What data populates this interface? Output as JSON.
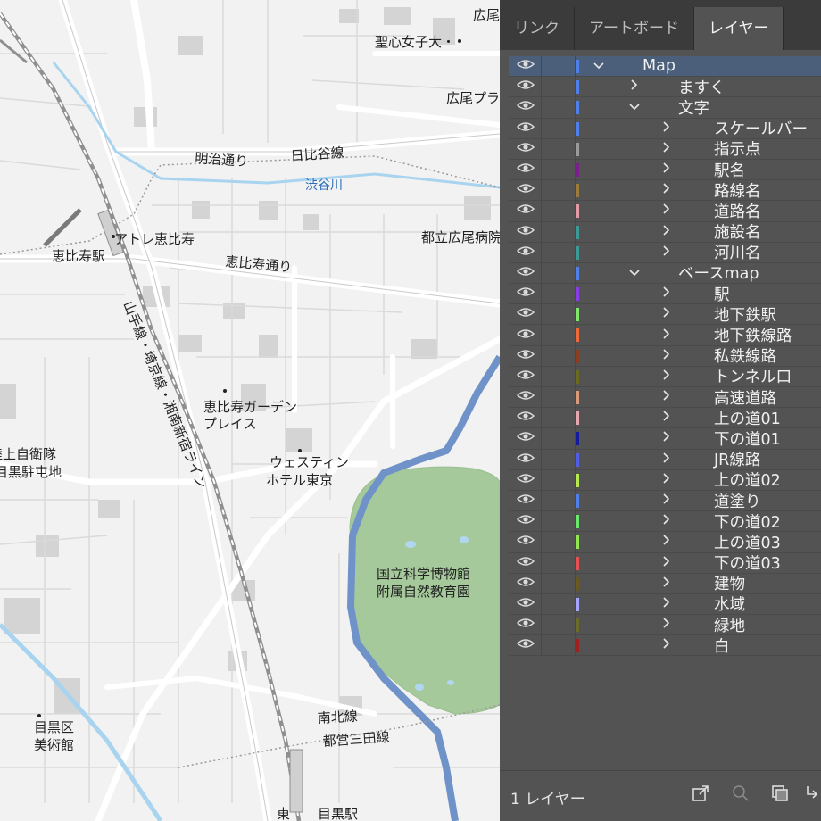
{
  "map": {
    "labels": {
      "hiroo": "広尾",
      "seishin": "聖心女子大・",
      "hiroo_plaza": "広尾プラ",
      "meiji_dori": "明治通り",
      "hibiya_line": "日比谷線",
      "shibuya_river": "渋谷川",
      "atre": "アトレ恵比寿",
      "ebisu_station": "恵比寿駅",
      "ebisu_dori": "恵比寿通り",
      "toritsu_hiroo": "都立広尾病院",
      "yamanote_line": "山手線・埼京線・湘南新宿ライン",
      "garden_place_1": "恵比寿ガーデン",
      "garden_place_2": "プレイス",
      "westin_1": "ウェスティン",
      "westin_2": "ホテル東京",
      "jsdf_1": "陸上自衛隊",
      "jsdf_2": "目黒駐屯地",
      "museum_1": "国立科学博物館",
      "museum_2": "附属自然教育園",
      "namboku": "南北線",
      "mita": "都営三田線",
      "meguro_museum_1": "目黒区",
      "meguro_museum_2": "美術館",
      "meguro_station": "目黒駅",
      "east_fragment": "東"
    }
  },
  "panel": {
    "tabs": [
      {
        "label": "リンク",
        "active": false
      },
      {
        "label": "アートボード",
        "active": false
      },
      {
        "label": "レイヤー",
        "active": true
      }
    ],
    "layers": [
      {
        "name": "Map",
        "level": 0,
        "expanded": true,
        "color": "#4f7fe8",
        "selected": true
      },
      {
        "name": "ますく",
        "level": 1,
        "expanded": false,
        "color": "#4f7fe8"
      },
      {
        "name": "文字",
        "level": 1,
        "expanded": true,
        "color": "#4f7fe8"
      },
      {
        "name": "スケールバー",
        "level": 2,
        "expanded": false,
        "color": "#4f7fe8"
      },
      {
        "name": "指示点",
        "level": 2,
        "expanded": false,
        "color": "#9a9a9a"
      },
      {
        "name": "駅名",
        "level": 2,
        "expanded": false,
        "color": "#7a1f8c"
      },
      {
        "name": "路線名",
        "level": 2,
        "expanded": false,
        "color": "#9c7a3c"
      },
      {
        "name": "道路名",
        "level": 2,
        "expanded": false,
        "color": "#e29aa6"
      },
      {
        "name": "施設名",
        "level": 2,
        "expanded": false,
        "color": "#3b9a96"
      },
      {
        "name": "河川名",
        "level": 2,
        "expanded": false,
        "color": "#3b9a96"
      },
      {
        "name": "ベースmap",
        "level": 1,
        "expanded": true,
        "color": "#4f7fe8"
      },
      {
        "name": "駅",
        "level": 2,
        "expanded": false,
        "color": "#8a3ce8"
      },
      {
        "name": "地下鉄駅",
        "level": 2,
        "expanded": false,
        "color": "#7fe86a"
      },
      {
        "name": "地下鉄線路",
        "level": 2,
        "expanded": false,
        "color": "#ec6a3a"
      },
      {
        "name": "私鉄線路",
        "level": 2,
        "expanded": false,
        "color": "#8c3c1f"
      },
      {
        "name": "トンネル口",
        "level": 2,
        "expanded": false,
        "color": "#6b6b1f"
      },
      {
        "name": "高速道路",
        "level": 2,
        "expanded": false,
        "color": "#d99a7a"
      },
      {
        "name": "上の道01",
        "level": 2,
        "expanded": false,
        "color": "#e8a6b0"
      },
      {
        "name": "下の道01",
        "level": 2,
        "expanded": false,
        "color": "#141aa0"
      },
      {
        "name": "JR線路",
        "level": 2,
        "expanded": false,
        "color": "#4f5fe8"
      },
      {
        "name": "上の道02",
        "level": 2,
        "expanded": false,
        "color": "#b6e84f"
      },
      {
        "name": "道塗り",
        "level": 2,
        "expanded": false,
        "color": "#4f7fe8"
      },
      {
        "name": "下の道02",
        "level": 2,
        "expanded": false,
        "color": "#6ae86a"
      },
      {
        "name": "上の道03",
        "level": 2,
        "expanded": false,
        "color": "#8fe84f"
      },
      {
        "name": "下の道03",
        "level": 2,
        "expanded": false,
        "color": "#e84f4f"
      },
      {
        "name": "建物",
        "level": 2,
        "expanded": false,
        "color": "#6b5a1f"
      },
      {
        "name": "水域",
        "level": 2,
        "expanded": false,
        "color": "#a6a6ff"
      },
      {
        "name": "緑地",
        "level": 2,
        "expanded": false,
        "color": "#6b6b2a"
      },
      {
        "name": "白",
        "level": 2,
        "expanded": false,
        "color": "#a01f1f"
      }
    ],
    "footer": {
      "count": "1 レイヤー"
    }
  }
}
